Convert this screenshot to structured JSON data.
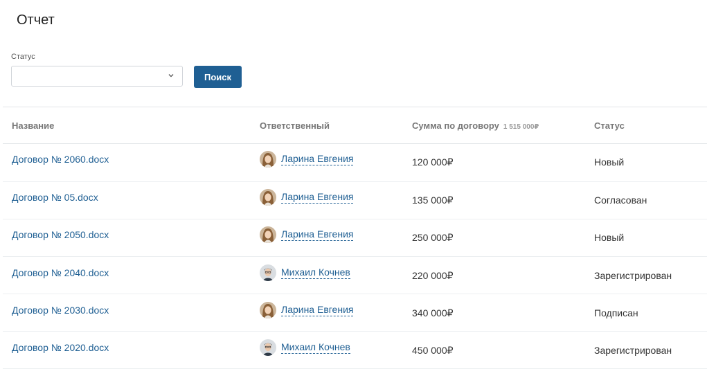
{
  "page": {
    "title": "Отчет"
  },
  "filter": {
    "status_label": "Статус",
    "status_value": "",
    "search_button": "Поиск"
  },
  "table": {
    "headers": {
      "name": "Название",
      "responsible": "Ответственный",
      "sum": "Сумма по договору",
      "sum_total": "1 515 000₽",
      "status": "Статус"
    },
    "rows": [
      {
        "name": "Договор № 2060.docx",
        "responsible": "Ларина Евгения",
        "avatar": "female",
        "sum": "120 000₽",
        "status": "Новый"
      },
      {
        "name": "Договор № 05.docx",
        "responsible": "Ларина Евгения",
        "avatar": "female",
        "sum": "135 000₽",
        "status": "Согласован"
      },
      {
        "name": "Договор № 2050.docx",
        "responsible": "Ларина Евгения",
        "avatar": "female",
        "sum": "250 000₽",
        "status": "Новый"
      },
      {
        "name": "Договор № 2040.docx",
        "responsible": "Михаил Кочнев",
        "avatar": "male",
        "sum": "220 000₽",
        "status": "Зарегистрирован"
      },
      {
        "name": "Договор № 2030.docx",
        "responsible": "Ларина Евгения",
        "avatar": "female",
        "sum": "340 000₽",
        "status": "Подписан"
      },
      {
        "name": "Договор № 2020.docx",
        "responsible": "Михаил Кочнев",
        "avatar": "male",
        "sum": "450 000₽",
        "status": "Зарегистрирован"
      }
    ]
  }
}
